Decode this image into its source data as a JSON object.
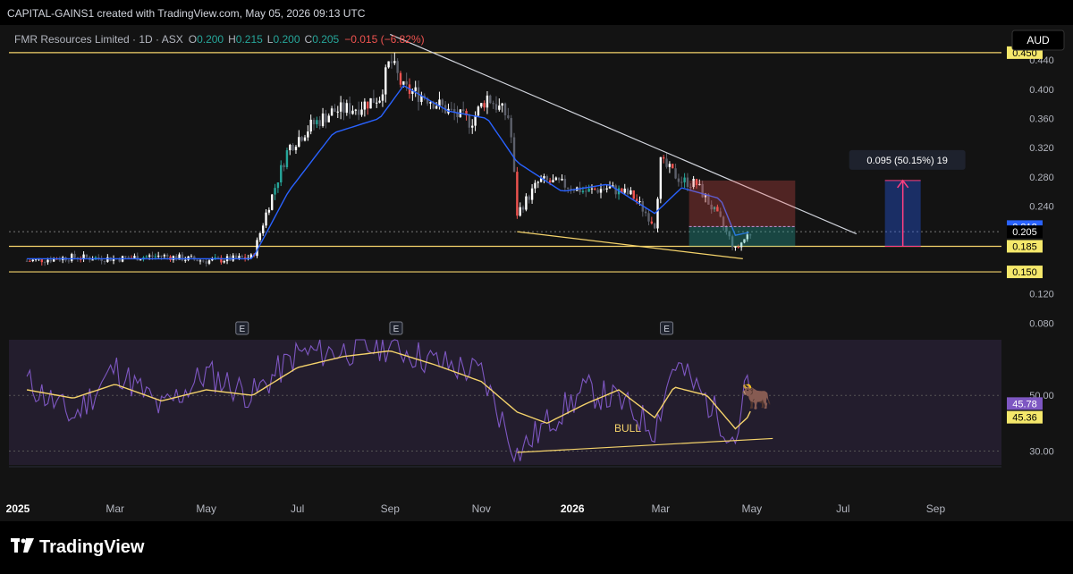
{
  "header": {
    "caption": "CAPITAL-GAINS1 created with TradingView.com, May 05, 2026 09:13 UTC"
  },
  "legend": {
    "symbol": "FMR Resources Limited · 1D · ASX",
    "o_label": "O",
    "o_value": "0.200",
    "h_label": "H",
    "h_value": "0.215",
    "l_label": "L",
    "l_value": "0.200",
    "c_label": "C",
    "c_value": "0.205",
    "change": "−0.015 (−6.82%)"
  },
  "currency_button": "AUD",
  "measure_label": "0.095 (50.15%) 19",
  "rsi_annotation": "BULL",
  "earnings_marker": "E",
  "brand": {
    "name": "TradingView",
    "logo_icon": "tradingview-logo-icon"
  },
  "colors": {
    "up": "#26a69a",
    "down": "#ef5350",
    "accent_blue": "#2962ff",
    "trend_yellow": "#f5d36b",
    "rsi": "#7e57c2"
  },
  "chart_data": [
    {
      "type": "candlestick",
      "title": "FMR Resources Limited · 1D · ASX",
      "x_tick_labels": [
        "2025",
        "Mar",
        "May",
        "Jul",
        "Sep",
        "Nov",
        "2026",
        "Mar",
        "May",
        "Jul",
        "Sep"
      ],
      "y_tick_labels": [
        "0.450",
        "0.440",
        "0.400",
        "0.360",
        "0.320",
        "0.280",
        "0.240",
        "0.212",
        "0.205",
        "0.205",
        "0.185",
        "0.150",
        "0.120",
        "0.080"
      ],
      "ylim": [
        0.062,
        0.478
      ],
      "price_labels": [
        {
          "value": 0.45,
          "text": "0.450",
          "style": "yellow"
        },
        {
          "value": 0.212,
          "text": "0.212",
          "style": "blue"
        },
        {
          "value": 0.205,
          "text": "0.205",
          "style": "dark"
        },
        {
          "value": 0.185,
          "text": "0.185",
          "style": "yellow"
        },
        {
          "value": 0.15,
          "text": "0.150",
          "style": "yellow"
        }
      ],
      "close_series": {
        "x": [
          "2025-01-01",
          "2025-02-01",
          "2025-03-01",
          "2025-04-01",
          "2025-05-01",
          "2025-06-01",
          "2025-06-10",
          "2025-06-25",
          "2025-07-10",
          "2025-07-25",
          "2025-08-10",
          "2025-08-25",
          "2025-09-01",
          "2025-09-10",
          "2025-09-25",
          "2025-10-10",
          "2025-10-25",
          "2025-11-05",
          "2025-11-20",
          "2025-11-25",
          "2025-12-10",
          "2025-12-25",
          "2026-01-10",
          "2026-01-25",
          "2026-02-10",
          "2026-02-25",
          "2026-03-01",
          "2026-03-15",
          "2026-03-25",
          "2026-04-10",
          "2026-04-20",
          "2026-04-28",
          "2026-05-01"
        ],
        "y": [
          0.165,
          0.17,
          0.168,
          0.172,
          0.165,
          0.17,
          0.23,
          0.32,
          0.35,
          0.37,
          0.375,
          0.39,
          0.44,
          0.4,
          0.39,
          0.37,
          0.355,
          0.39,
          0.36,
          0.23,
          0.275,
          0.27,
          0.26,
          0.265,
          0.255,
          0.215,
          0.3,
          0.275,
          0.27,
          0.22,
          0.18,
          0.2,
          0.205
        ]
      },
      "moving_average": {
        "x": [
          "2025-01-01",
          "2025-06-01",
          "2025-06-25",
          "2025-07-25",
          "2025-08-25",
          "2025-09-10",
          "2025-10-10",
          "2025-11-05",
          "2025-11-25",
          "2025-12-25",
          "2026-01-25",
          "2026-02-25",
          "2026-03-15",
          "2026-04-10",
          "2026-04-20",
          "2026-05-01"
        ],
        "y": [
          0.168,
          0.168,
          0.26,
          0.34,
          0.36,
          0.405,
          0.37,
          0.36,
          0.3,
          0.26,
          0.27,
          0.23,
          0.265,
          0.25,
          0.2,
          0.205
        ]
      },
      "trendlines": [
        {
          "from": [
            "2025-09-01",
            0.475
          ],
          "to": [
            "2026-07-10",
            0.202
          ],
          "style": "white"
        },
        {
          "from": [
            "2025-11-25",
            0.205
          ],
          "to": [
            "2026-04-25",
            0.168
          ],
          "style": "yellow"
        }
      ],
      "horizontal_levels": [
        0.45,
        0.185,
        0.15
      ],
      "position_tool": {
        "x_start": "2026-03-20",
        "x_end": "2026-05-30",
        "entry": 0.212,
        "target": 0.275,
        "stop": 0.185
      },
      "price_range_measure": {
        "x": "2026-08-10",
        "from": 0.185,
        "to": 0.275,
        "label": "0.095 (50.15%) 19"
      },
      "earnings_events": [
        "2025-05-25",
        "2025-09-05",
        "2026-03-05"
      ]
    },
    {
      "type": "line",
      "title": "RSI",
      "y_tick_labels": [
        "50.00",
        "45.78",
        "45.36",
        "30.00"
      ],
      "ylim": [
        25,
        70
      ],
      "series": [
        {
          "name": "",
          "color": "#7e57c2",
          "x": [
            "2025-01-01",
            "2025-02-01",
            "2025-03-01",
            "2025-04-01",
            "2025-05-01",
            "2025-06-01",
            "2025-07-01",
            "2025-08-01",
            "2025-09-01",
            "2025-10-01",
            "2025-11-01",
            "2025-11-25",
            "2025-12-15",
            "2026-01-10",
            "2026-02-01",
            "2026-02-25",
            "2026-03-10",
            "2026-04-01",
            "2026-04-20",
            "2026-04-28",
            "2026-05-01"
          ],
          "y": [
            55,
            42,
            60,
            45,
            58,
            50,
            65,
            66,
            68,
            62,
            58,
            29,
            40,
            52,
            48,
            38,
            62,
            48,
            34,
            56,
            45.78
          ]
        },
        {
          "name": "",
          "color": "#f5d36b",
          "x": [
            "2025-01-01",
            "2025-02-01",
            "2025-03-01",
            "2025-04-01",
            "2025-05-01",
            "2025-06-01",
            "2025-07-01",
            "2025-08-01",
            "2025-09-01",
            "2025-10-01",
            "2025-11-01",
            "2025-11-25",
            "2025-12-15",
            "2026-01-10",
            "2026-02-01",
            "2026-02-25",
            "2026-03-10",
            "2026-04-01",
            "2026-04-20",
            "2026-04-28",
            "2026-05-01"
          ],
          "y": [
            52,
            49,
            54,
            48,
            52,
            50,
            60,
            64,
            66,
            61,
            55,
            44,
            40,
            47,
            52,
            42,
            53,
            50,
            38,
            42,
            45.36
          ]
        }
      ],
      "levels": [
        50,
        30
      ],
      "bull_divergence": {
        "from": [
          "2025-11-25",
          29.5
        ],
        "to": [
          "2026-05-15",
          34.5
        ],
        "label": "BULL"
      }
    }
  ]
}
